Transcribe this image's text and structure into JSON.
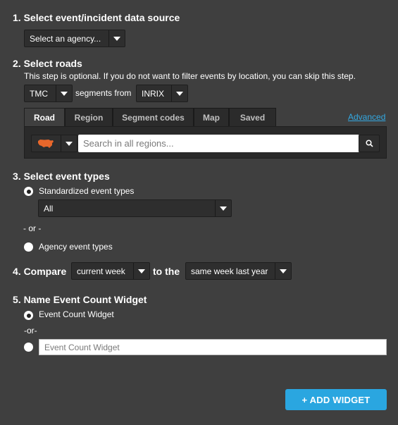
{
  "step1": {
    "heading": "1. Select event/incident data source",
    "agency_select": "Select an agency..."
  },
  "step2": {
    "heading": "2. Select roads",
    "note": "This step is optional. If you do not want to filter events by location, you can skip this step.",
    "segment_type": "TMC",
    "segments_from_label": "segments from",
    "segment_source": "INRIX",
    "tabs": [
      "Road",
      "Region",
      "Segment codes",
      "Map",
      "Saved"
    ],
    "active_tab": "Road",
    "advanced_link": "Advanced",
    "region_icon": "usa-map-icon",
    "search_placeholder": "Search in all regions...",
    "search_icon": "search-icon"
  },
  "step3": {
    "heading": "3. Select event types",
    "standardized_label": "Standardized event types",
    "standardized_select": "All",
    "or_text": "- or -",
    "agency_label": "Agency event types"
  },
  "step4": {
    "heading": "4. Compare",
    "period": "current week",
    "to_the_label": "to the",
    "baseline": "same week last year"
  },
  "step5": {
    "heading": "5. Name Event Count Widget",
    "default_name_label": "Event Count Widget",
    "or_text": "-or-",
    "custom_name_placeholder": "Event Count Widget"
  },
  "add_button": "+ ADD WIDGET",
  "colors": {
    "background": "#3f3f3f",
    "dropdown": "#2e2e2e",
    "accent": "#2aa6e0",
    "link": "#33a9e3",
    "map_orange": "#e8672b"
  }
}
